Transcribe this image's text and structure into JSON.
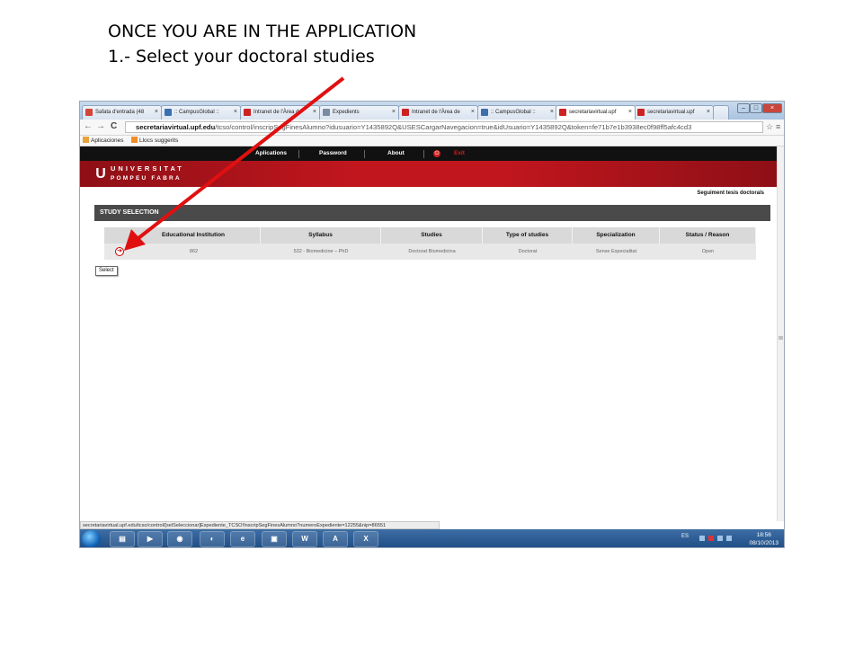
{
  "slide": {
    "line1": "ONCE YOU ARE IN THE APPLICATION",
    "line2": "1.- Select your doctoral studies"
  },
  "browser": {
    "tabs": [
      {
        "label": "Safata d'entrada (48",
        "favicon_color": "#d44638"
      },
      {
        "label": ":: CampusGlobal ::",
        "favicon_color": "#3b6fb0"
      },
      {
        "label": "Intranet de l'Àrea de",
        "favicon_color": "#cc2222"
      },
      {
        "label": "Expedients",
        "favicon_color": "#7a8ca3"
      },
      {
        "label": "Intranet de l'Àrea de",
        "favicon_color": "#cc2222"
      },
      {
        "label": ":: CampusGlobal ::",
        "favicon_color": "#3b6fb0"
      },
      {
        "label": "secretariavirtual.upf",
        "favicon_color": "#cc2222"
      },
      {
        "label": "secretariavirtual.upf",
        "favicon_color": "#cc2222"
      }
    ],
    "url_host": "secretariavirtual.upf.edu",
    "url_path": "/tcso/control/inscripSegFinesAlumno?idusuario=Y1435892Q&USESCargarNavegacion=true&idUsuario=Y1435892Q&token=fe71b7e1b3938ec0f98ff5afc4cd3",
    "bookmarks": [
      {
        "label": "Aplicaciones",
        "color": "#e8a33c"
      },
      {
        "label": "Llocs suggerits",
        "color": "#f28c28"
      }
    ],
    "status_url": "secretariavirtual.upf.edu/tcso/control/[selSeleccionar]Expediente_TCSO!InscripSegFinesAlumno?numeroExpediente=12255&nip=86551"
  },
  "site": {
    "nav": [
      "Aplications",
      "Password",
      "About"
    ],
    "exit_label": "Exit",
    "logo_text": "U",
    "university_line1": "UNIVERSITAT",
    "university_line2": "POMPEU FABRA",
    "subheader": "Seguiment tesis doctorals",
    "section_title": "STUDY SELECTION",
    "table": {
      "headers": [
        "Educational Institution",
        "Syllabus",
        "Studies",
        "Type of studies",
        "Specialization",
        "Status / Reason"
      ],
      "rows": [
        [
          "862",
          "532 - Biomedicine – PhD",
          "Doctorat Biomedicina",
          "Doctorat",
          "Sense Especialitat",
          "Open"
        ]
      ]
    },
    "select_tooltip": "Select"
  },
  "taskbar": {
    "apps": [
      "file-explorer",
      "media-player",
      "chrome",
      "app",
      "internet-explorer",
      "app",
      "word",
      "acrobat",
      "excel"
    ],
    "language": "ES",
    "time": "18:56",
    "date": "08/10/2013"
  },
  "colors": {
    "upf_red": "#c2161e",
    "annotation_arrow": "#e01010"
  }
}
